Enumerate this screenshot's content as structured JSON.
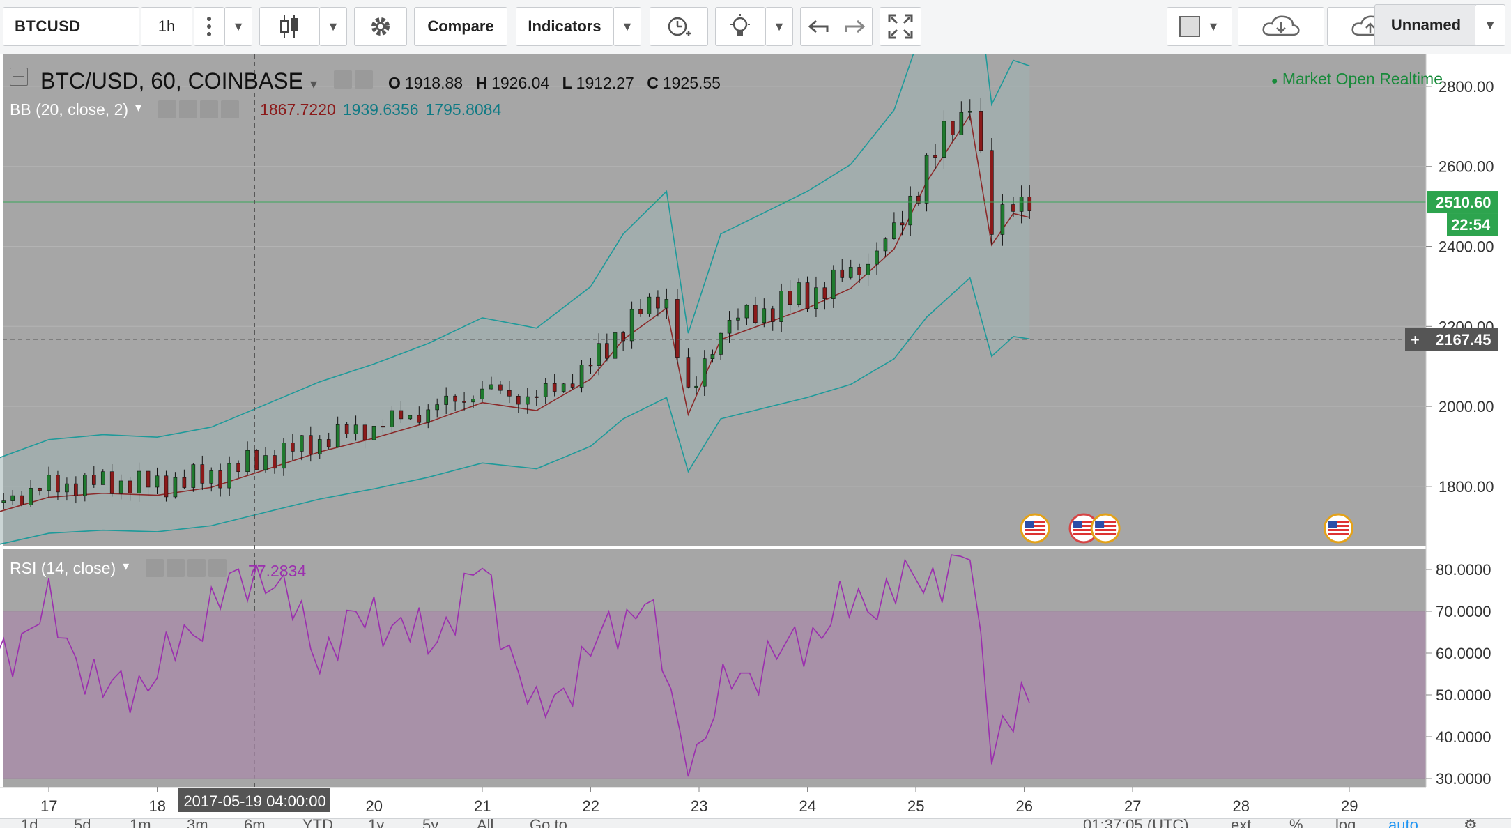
{
  "toolbar": {
    "symbol": "BTCUSD",
    "interval": "1h",
    "compare_label": "Compare",
    "indicators_label": "Indicators",
    "layout_name": "Unnamed"
  },
  "legend": {
    "title": "BTC/USD, 60, COINBASE",
    "open_label": "O",
    "open": "1918.88",
    "high_label": "H",
    "high": "1926.04",
    "low_label": "L",
    "low": "1912.27",
    "close_label": "C",
    "close": "1925.55",
    "bb_title": "BB (20, close, 2)",
    "bb_basis": "1867.7220",
    "bb_upper": "1939.6356",
    "bb_lower": "1795.8084",
    "market_status": "Market Open",
    "realtime": "Realtime",
    "rsi_title": "RSI (14, close)",
    "rsi_value": "77.2834"
  },
  "price_scale": {
    "ticks": [
      "2800.00",
      "2600.00",
      "2400.00",
      "2200.00",
      "2000.00",
      "1800.00"
    ],
    "last_price": "2510.60",
    "countdown": "22:54",
    "crosshair_price": "2167.45"
  },
  "rsi_scale": {
    "ticks": [
      "80.0000",
      "70.0000",
      "60.0000",
      "50.0000",
      "40.0000",
      "30.0000"
    ]
  },
  "time_scale": {
    "labels": [
      "17",
      "18",
      "20",
      "21",
      "22",
      "23",
      "24",
      "25",
      "26",
      "27",
      "28",
      "29"
    ],
    "crosshair_time": "2017-05-19 04:00:00"
  },
  "bottom_bar": {
    "ranges": [
      "1d",
      "5d",
      "1m",
      "3m",
      "6m",
      "YTD",
      "1y",
      "5y",
      "All"
    ],
    "goto": "Go to...",
    "clock": "01:37:05 (UTC)",
    "adj": "ext",
    "pct": "%",
    "log": "log",
    "auto": "auto"
  },
  "colors": {
    "pane_bg": "#a6a6a6",
    "up_candle": "#1f7a2e",
    "down_candle": "#8b1a1a",
    "bb_band": "#1e9a9a",
    "bb_basis": "#8b2a2a",
    "rsi_line": "#9b2fae",
    "rsi_band_fill": "#a88aa8",
    "last_price_bg": "#2da44e",
    "accent_blue": "#2196f3"
  },
  "chart_data": {
    "type": "candlestick",
    "symbol": "BTC/USD",
    "interval": "60",
    "exchange": "COINBASE",
    "x_axis": "day of month (May 2017)",
    "price_ylim": [
      1650,
      2880
    ],
    "price_series": [
      {
        "day": 16.5,
        "close": 1760
      },
      {
        "day": 17.0,
        "close": 1800
      },
      {
        "day": 17.5,
        "close": 1810
      },
      {
        "day": 18.0,
        "close": 1805
      },
      {
        "day": 18.5,
        "close": 1825
      },
      {
        "day": 19.0,
        "close": 1870
      },
      {
        "day": 19.5,
        "close": 1915
      },
      {
        "day": 20.0,
        "close": 1950
      },
      {
        "day": 20.5,
        "close": 1990
      },
      {
        "day": 21.0,
        "close": 2040
      },
      {
        "day": 21.5,
        "close": 2020
      },
      {
        "day": 22.0,
        "close": 2100
      },
      {
        "day": 22.3,
        "close": 2200
      },
      {
        "day": 22.7,
        "close": 2280
      },
      {
        "day": 22.9,
        "close": 2010
      },
      {
        "day": 23.2,
        "close": 2200
      },
      {
        "day": 23.6,
        "close": 2240
      },
      {
        "day": 24.0,
        "close": 2280
      },
      {
        "day": 24.4,
        "close": 2330
      },
      {
        "day": 24.8,
        "close": 2430
      },
      {
        "day": 25.1,
        "close": 2600
      },
      {
        "day": 25.5,
        "close": 2770
      },
      {
        "day": 25.7,
        "close": 2440
      },
      {
        "day": 25.9,
        "close": 2520
      },
      {
        "day": 26.05,
        "close": 2510
      }
    ],
    "bb_upper_series": [
      1790,
      1840,
      1880,
      1960,
      2090,
      2100,
      2280,
      2300,
      2360,
      2450,
      2660,
      2860
    ],
    "bb_lower_series": [
      1690,
      1740,
      1770,
      1830,
      1960,
      1980,
      2010,
      2120,
      2180,
      2280,
      2380,
      2360
    ],
    "rsi_ylim": [
      28,
      85
    ],
    "rsi_band": [
      30,
      70
    ],
    "rsi_series": [
      {
        "day": 16.5,
        "value": 58
      },
      {
        "day": 17.0,
        "value": 70
      },
      {
        "day": 17.5,
        "value": 50
      },
      {
        "day": 18.0,
        "value": 55
      },
      {
        "day": 18.5,
        "value": 72
      },
      {
        "day": 19.0,
        "value": 80
      },
      {
        "day": 19.5,
        "value": 60
      },
      {
        "day": 20.0,
        "value": 70
      },
      {
        "day": 20.5,
        "value": 62
      },
      {
        "day": 21.0,
        "value": 80
      },
      {
        "day": 21.5,
        "value": 44
      },
      {
        "day": 22.0,
        "value": 60
      },
      {
        "day": 22.5,
        "value": 74
      },
      {
        "day": 22.9,
        "value": 32
      },
      {
        "day": 23.3,
        "value": 54
      },
      {
        "day": 23.8,
        "value": 60
      },
      {
        "day": 24.3,
        "value": 70
      },
      {
        "day": 24.9,
        "value": 76
      },
      {
        "day": 25.5,
        "value": 82
      },
      {
        "day": 25.7,
        "value": 40
      },
      {
        "day": 25.9,
        "value": 46
      },
      {
        "day": 26.05,
        "value": 48
      }
    ]
  }
}
